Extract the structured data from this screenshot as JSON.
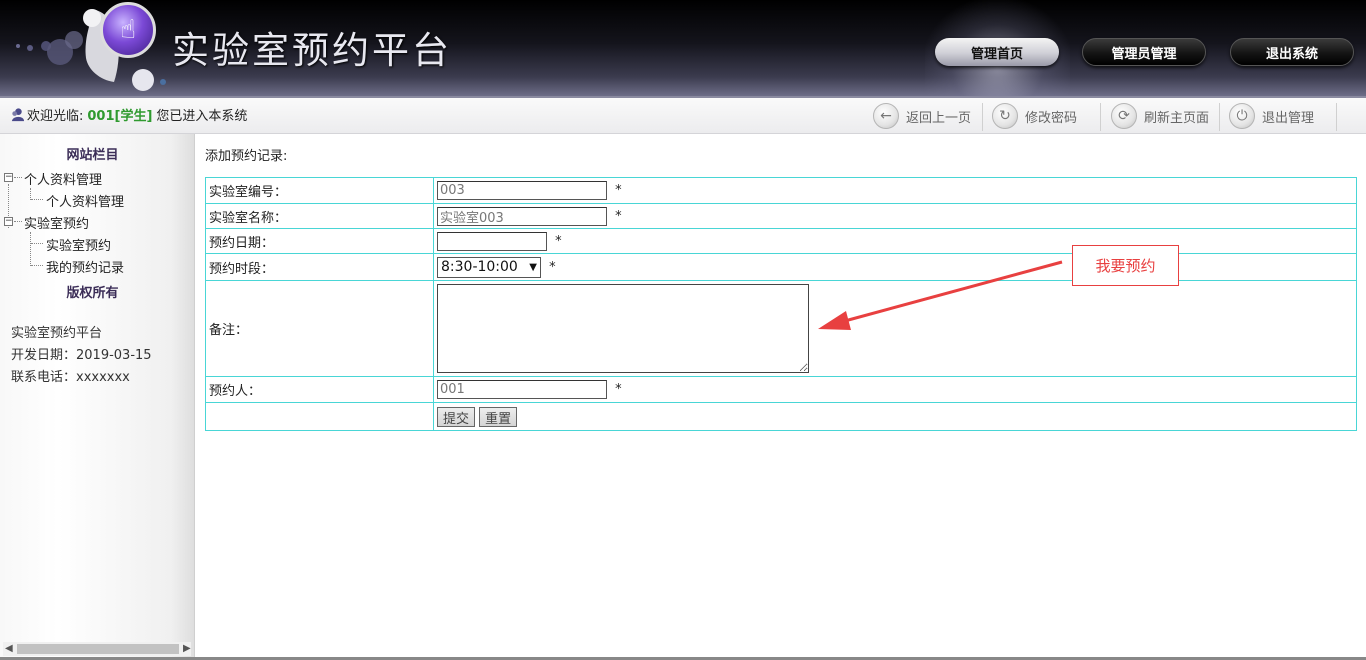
{
  "header": {
    "title": "实验室预约平台",
    "nav": [
      "管理首页",
      "管理员管理",
      "退出系统"
    ]
  },
  "toolbar": {
    "welcome_prefix": "欢迎光临:",
    "user": "001[学生]",
    "welcome_suffix": "您已进入本系统",
    "buttons": [
      "返回上一页",
      "修改密码",
      "刷新主页面",
      "退出管理"
    ]
  },
  "sidebar": {
    "heading": "网站栏目",
    "groups": [
      {
        "label": "个人资料管理",
        "items": [
          "个人资料管理"
        ]
      },
      {
        "label": "实验室预约",
        "items": [
          "实验室预约",
          "我的预约记录"
        ]
      }
    ],
    "copyright_heading": "版权所有",
    "info": [
      "实验室预约平台",
      "开发日期：2019-03-15",
      "联系电话：xxxxxxx"
    ]
  },
  "form": {
    "title": "添加预约记录:",
    "fields": {
      "lab_id_label": "实验室编号：",
      "lab_id_value": "003",
      "lab_name_label": "实验室名称：",
      "lab_name_value": "实验室003",
      "date_label": "预约日期：",
      "date_value": "",
      "slot_label": "预约时段：",
      "slot_value": "8:30-10:00",
      "remark_label": "备注：",
      "person_label": "预约人：",
      "person_value": "001"
    },
    "required_mark": "*",
    "submit": "提交",
    "reset": "重置"
  },
  "annotation": {
    "text": "我要预约",
    "color": "#e84040"
  },
  "colors": {
    "border_accent": "#49d6d6",
    "user_highlight": "#2f9a2f"
  }
}
